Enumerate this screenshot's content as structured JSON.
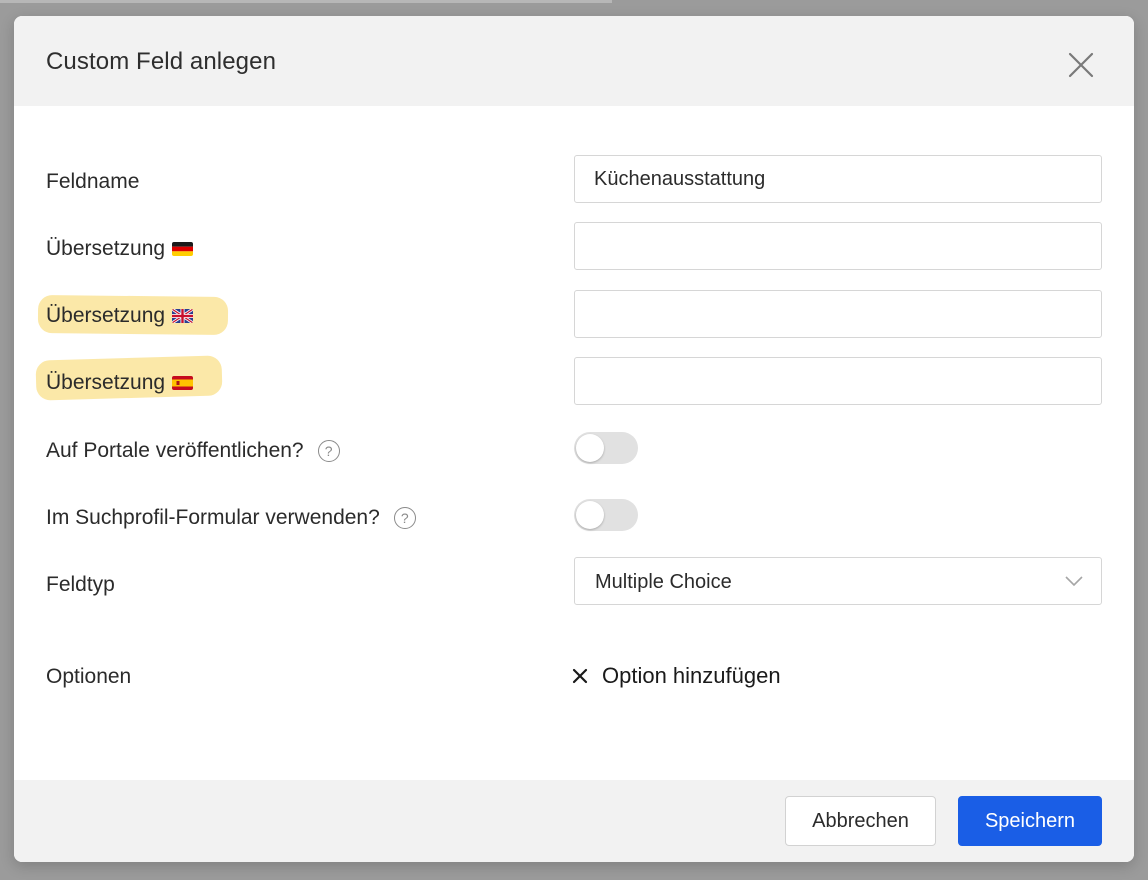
{
  "dialog": {
    "title": "Custom Feld anlegen",
    "close_icon": "close-icon"
  },
  "fields": {
    "feldname": {
      "label": "Feldname",
      "value": "Küchenausstattung"
    },
    "uebersetzung_de": {
      "label": "Übersetzung",
      "flag": "flag-de-icon",
      "value": ""
    },
    "uebersetzung_en": {
      "label": "Übersetzung",
      "flag": "flag-uk-icon",
      "value": "",
      "highlighted": true
    },
    "uebersetzung_es": {
      "label": "Übersetzung",
      "flag": "flag-es-icon",
      "value": "",
      "highlighted": true
    },
    "portale": {
      "label": "Auf Portale veröffentlichen?",
      "help_icon": "help-icon",
      "help_glyph": "?",
      "enabled": false
    },
    "suchprofil": {
      "label": "Im Suchprofil-Formular verwenden?",
      "help_icon": "help-icon",
      "help_glyph": "?",
      "enabled": false
    },
    "feldtyp": {
      "label": "Feldtyp",
      "selected": "Multiple Choice",
      "icon": "chevron-down-icon"
    },
    "optionen": {
      "label": "Optionen",
      "add_label": "Option hinzufügen",
      "add_icon": "close-x-icon"
    }
  },
  "footer": {
    "cancel_label": "Abbrechen",
    "save_label": "Speichern"
  },
  "colors": {
    "primary": "#1a5ee6",
    "highlight": "#fbe7a3",
    "header_bg": "#f2f2f2",
    "toggle_off": "#e1e1e1"
  }
}
